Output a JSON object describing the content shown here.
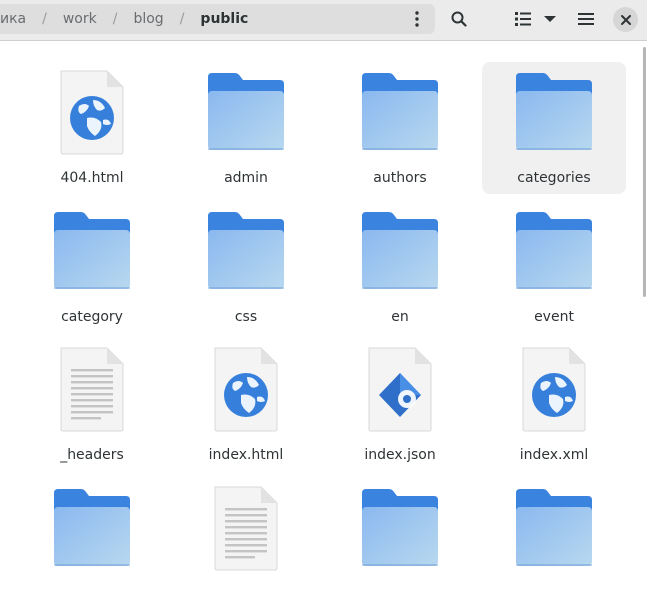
{
  "breadcrumbs": [
    "ика",
    "work",
    "blog",
    "public"
  ],
  "separator": "/",
  "icons": {
    "path_menu": "vertical-dots-icon",
    "search": "search-icon",
    "view": "list-view-icon",
    "view_options": "chevron-down-icon",
    "main_menu": "hamburger-menu-icon",
    "close": "close-icon"
  },
  "colors": {
    "folder_tab": "#3a84e0",
    "folder_body_top": "#8ab8ef",
    "folder_body_bottom": "#b8d8ef",
    "globe": "#3680dc",
    "selected_bg": "#f0f0f0"
  },
  "files": [
    {
      "name": "404.html",
      "type": "html"
    },
    {
      "name": "admin",
      "type": "folder"
    },
    {
      "name": "authors",
      "type": "folder"
    },
    {
      "name": "categories",
      "type": "folder",
      "selected": true
    },
    {
      "name": "category",
      "type": "folder"
    },
    {
      "name": "css",
      "type": "folder"
    },
    {
      "name": "en",
      "type": "folder"
    },
    {
      "name": "event",
      "type": "folder"
    },
    {
      "name": "_headers",
      "type": "text"
    },
    {
      "name": "index.html",
      "type": "html"
    },
    {
      "name": "index.json",
      "type": "json"
    },
    {
      "name": "index.xml",
      "type": "html"
    },
    {
      "name": "",
      "type": "folder"
    },
    {
      "name": "",
      "type": "text"
    },
    {
      "name": "",
      "type": "folder"
    },
    {
      "name": "",
      "type": "folder"
    }
  ]
}
